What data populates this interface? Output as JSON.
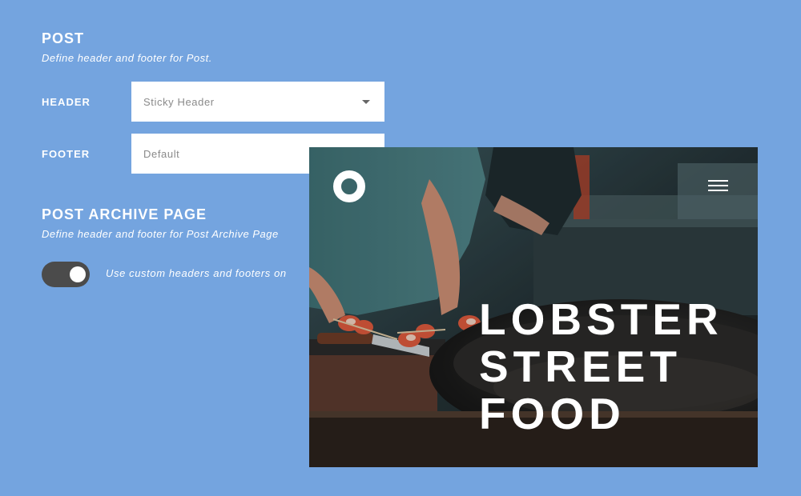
{
  "post": {
    "title": "POST",
    "description": "Define header and footer for Post.",
    "header_label": "HEADER",
    "header_value": "Sticky Header",
    "footer_label": "FOOTER",
    "footer_value": "Default"
  },
  "archive": {
    "title": "POST ARCHIVE PAGE",
    "description": "Define header and footer for Post Archive Page",
    "toggle_label": "Use custom headers and footers on",
    "toggle_on": true
  },
  "preview": {
    "headline_lines": [
      "LOBSTER",
      "STREET",
      "FOOD"
    ],
    "logo_icon": "ring-logo-icon",
    "menu_icon": "hamburger-menu-icon"
  },
  "colors": {
    "background": "#74a4df",
    "toggle_track": "#4b4b4b",
    "input_background": "#ffffff",
    "input_text": "#8a8a8a"
  }
}
